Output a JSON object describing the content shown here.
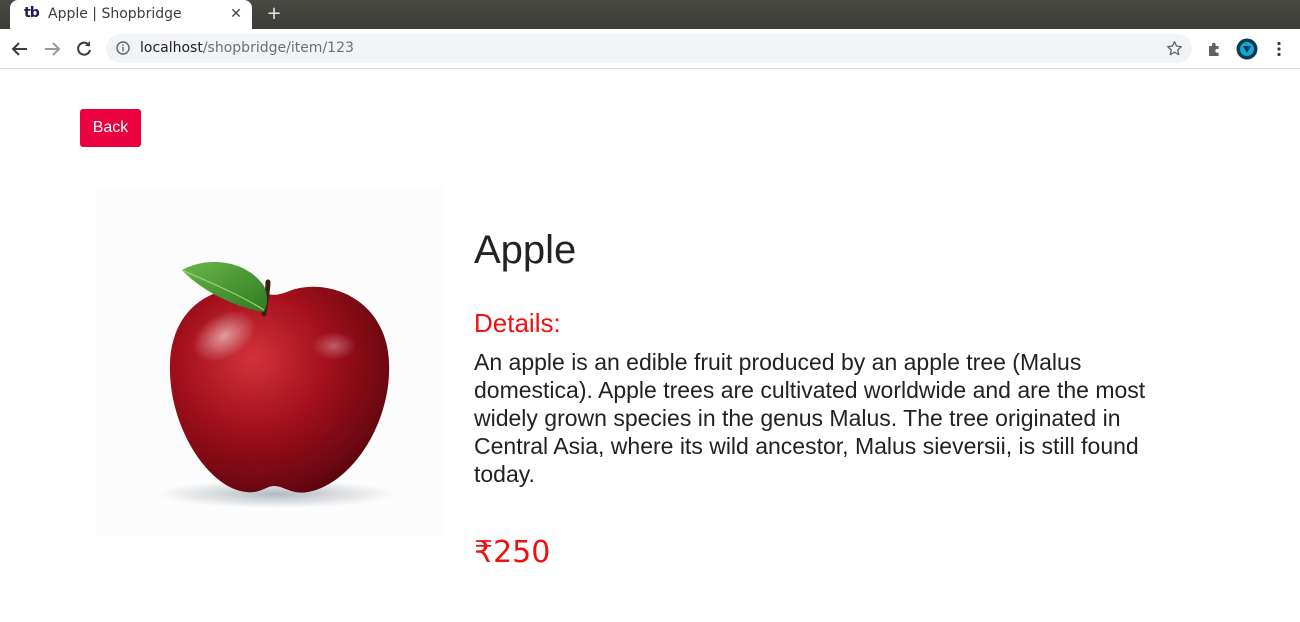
{
  "browser": {
    "tab": {
      "favicon_text": "tb",
      "title": "Apple | Shopbridge",
      "close_glyph": "✕"
    },
    "new_tab_glyph": "+",
    "address": {
      "host": "localhost",
      "path": "/shopbridge/item/123"
    },
    "icons": [
      "back-arrow-icon",
      "forward-arrow-icon",
      "reload-icon",
      "site-info-icon",
      "bookmark-star-icon",
      "extensions-puzzle-icon",
      "profile-avatar-icon",
      "menu-kebab-icon"
    ]
  },
  "page": {
    "back_label": "Back",
    "product": {
      "name": "Apple",
      "details_label": "Details:",
      "description": "An apple is an edible fruit produced by an apple tree (Malus domestica). Apple trees are cultivated worldwide and are the most widely grown species in the genus Malus. The tree originated in Central Asia, where its wild ancestor, Malus sieversii, is still found today.",
      "price": "₹250",
      "image_alt": "apple-image"
    }
  },
  "colors": {
    "accent": "#e9003e",
    "price_red": "#ee1111",
    "text": "#222222"
  }
}
